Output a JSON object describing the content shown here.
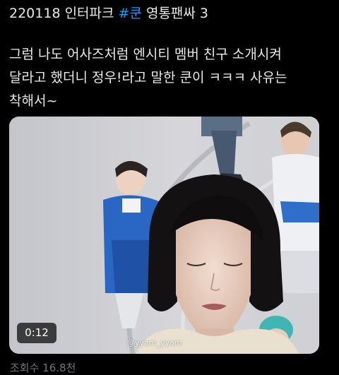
{
  "tweet": {
    "lines": [
      {
        "before": "220118 인터파크 ",
        "hashtag": "#쿤",
        "after": " 영통팬싸 3"
      },
      {
        "text": "그럼 나도 어사즈처럼 엔시티 멤버 친구 소개시켜"
      },
      {
        "text": "달라고 했더니 정우!라고 말한 쿤이 ㅋㅋㅋ 사유는"
      },
      {
        "text": "착해서~"
      }
    ],
    "hashtag_color": "#1d9bf0"
  },
  "video": {
    "duration": "0:12",
    "watermark": "@yyam_yyam"
  },
  "stats": {
    "views": "조회수 16.8천"
  }
}
